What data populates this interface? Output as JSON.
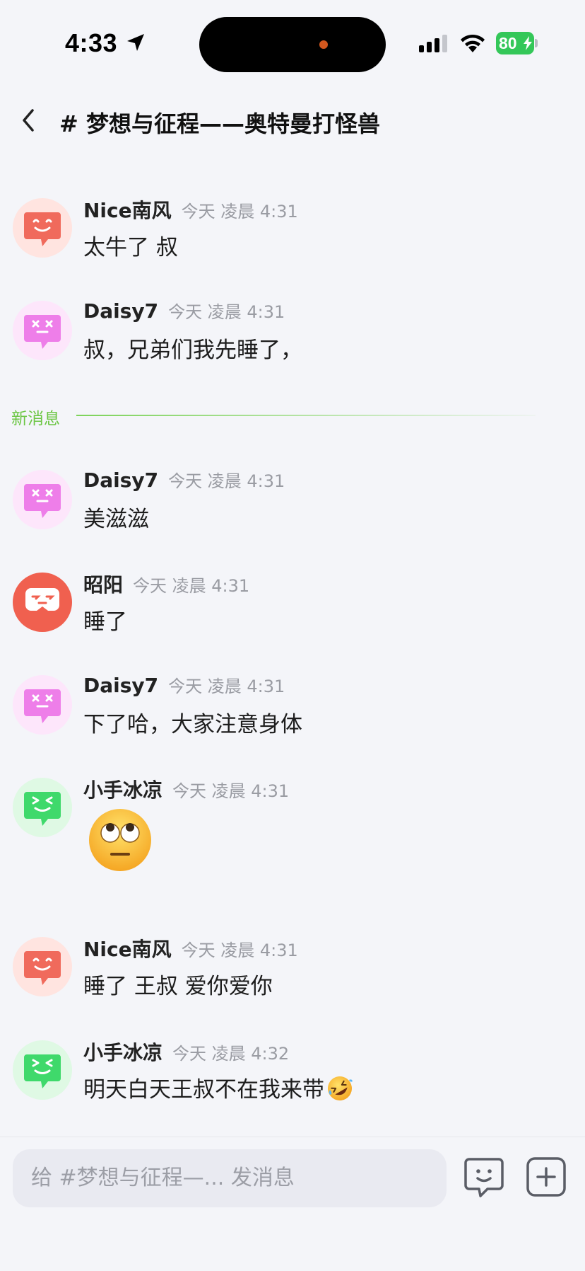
{
  "status_bar": {
    "time": "4:33",
    "battery": "80"
  },
  "header": {
    "channel_title": "# 梦想与征程——奥特曼打怪兽"
  },
  "divider": {
    "label": "新消息"
  },
  "messages": [
    {
      "sender": "Nice南风",
      "time": "今天 凌晨 4:31",
      "text": "太牛了 叔",
      "avatar": "pink-smile-icon"
    },
    {
      "sender": "Daisy7",
      "time": "今天 凌晨 4:31",
      "text": "叔，兄弟们我先睡了，",
      "avatar": "magenta-dizzy-icon"
    },
    {
      "sender": "Daisy7",
      "time": "今天 凌晨 4:31",
      "text": "美滋滋",
      "avatar": "magenta-dizzy-icon"
    },
    {
      "sender": "昭阳",
      "time": "今天 凌晨 4:31",
      "text": "睡了",
      "avatar": "red-gamepad-face-icon"
    },
    {
      "sender": "Daisy7",
      "time": "今天 凌晨 4:31",
      "text": "下了哈，大家注意身体",
      "avatar": "magenta-dizzy-icon"
    },
    {
      "sender": "小手冰凉",
      "time": "今天 凌晨 4:31",
      "text": "",
      "emoji": "eye-roll-emoji",
      "avatar": "green-squint-icon"
    },
    {
      "sender": "Nice南风",
      "time": "今天 凌晨 4:31",
      "text": "睡了 王叔 爱你爱你",
      "avatar": "pink-smile-icon"
    },
    {
      "sender": "小手冰凉",
      "time": "今天 凌晨 4:32",
      "text": "明天白天王叔不在我来带",
      "emoji": "rolling-laughing-emoji",
      "avatar": "green-squint-icon"
    }
  ],
  "composer": {
    "placeholder": "给 #梦想与征程—... 发消息"
  }
}
